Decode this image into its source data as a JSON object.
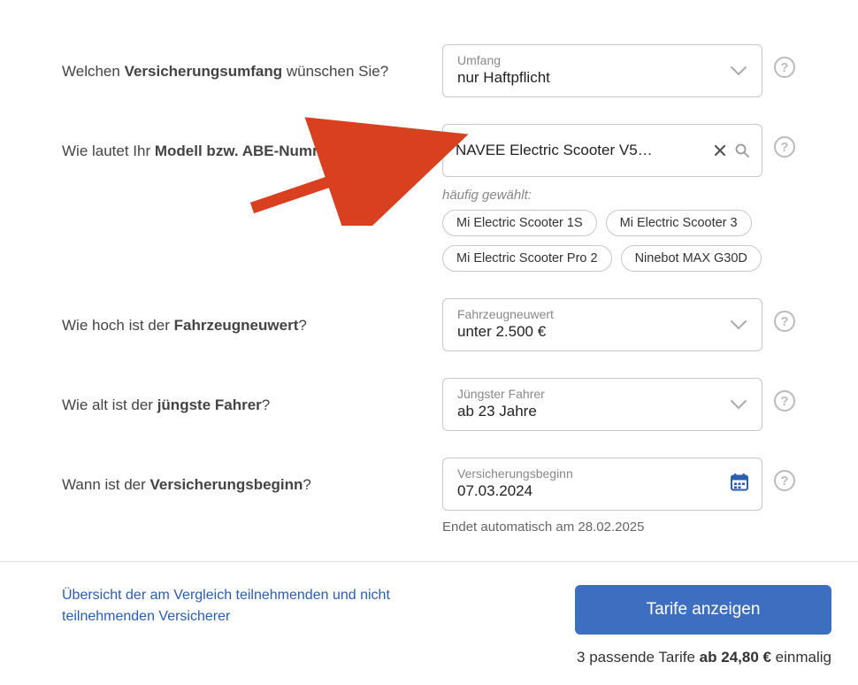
{
  "questions": {
    "coverage": {
      "label_pre": "Welchen ",
      "label_strong": "Versicherungsumfang",
      "label_post": " wünschen Sie?",
      "field_label": "Umfang",
      "value": "nur Haftpflicht"
    },
    "model": {
      "label_pre": "Wie lautet Ihr ",
      "label_strong": "Modell bzw. ABE-Nummer",
      "label_post": "?",
      "value": "NAVEE Electric Scooter V5…",
      "hint": "häufig gewählt:",
      "chips": [
        "Mi Electric Scooter 1S",
        "Mi Electric Scooter 3",
        "Mi Electric Scooter Pro 2",
        "Ninebot MAX G30D"
      ]
    },
    "newvalue": {
      "label_pre": "Wie hoch ist der ",
      "label_strong": "Fahrzeugneuwert",
      "label_post": "?",
      "field_label": "Fahrzeugneuwert",
      "value": "unter 2.500 €"
    },
    "driver": {
      "label_pre": "Wie alt ist der ",
      "label_strong": "jüngste Fahrer",
      "label_post": "?",
      "field_label": "Jüngster Fahrer",
      "value": "ab 23 Jahre"
    },
    "start": {
      "label_pre": "Wann ist der ",
      "label_strong": "Versicherungsbeginn",
      "label_post": "?",
      "field_label": "Versicherungsbeginn",
      "value": "07.03.2024",
      "note": "Endet automatisch am 28.02.2025"
    }
  },
  "footer": {
    "link": "Übersicht der am Vergleich teilnehmenden und nicht teilnehmenden Versicherer",
    "cta": "Tarife anzeigen",
    "result_pre": "3 passende Tarife ",
    "result_strong": "ab 24,80 €",
    "result_post": " einmalig"
  },
  "icons": {
    "help": "?"
  }
}
